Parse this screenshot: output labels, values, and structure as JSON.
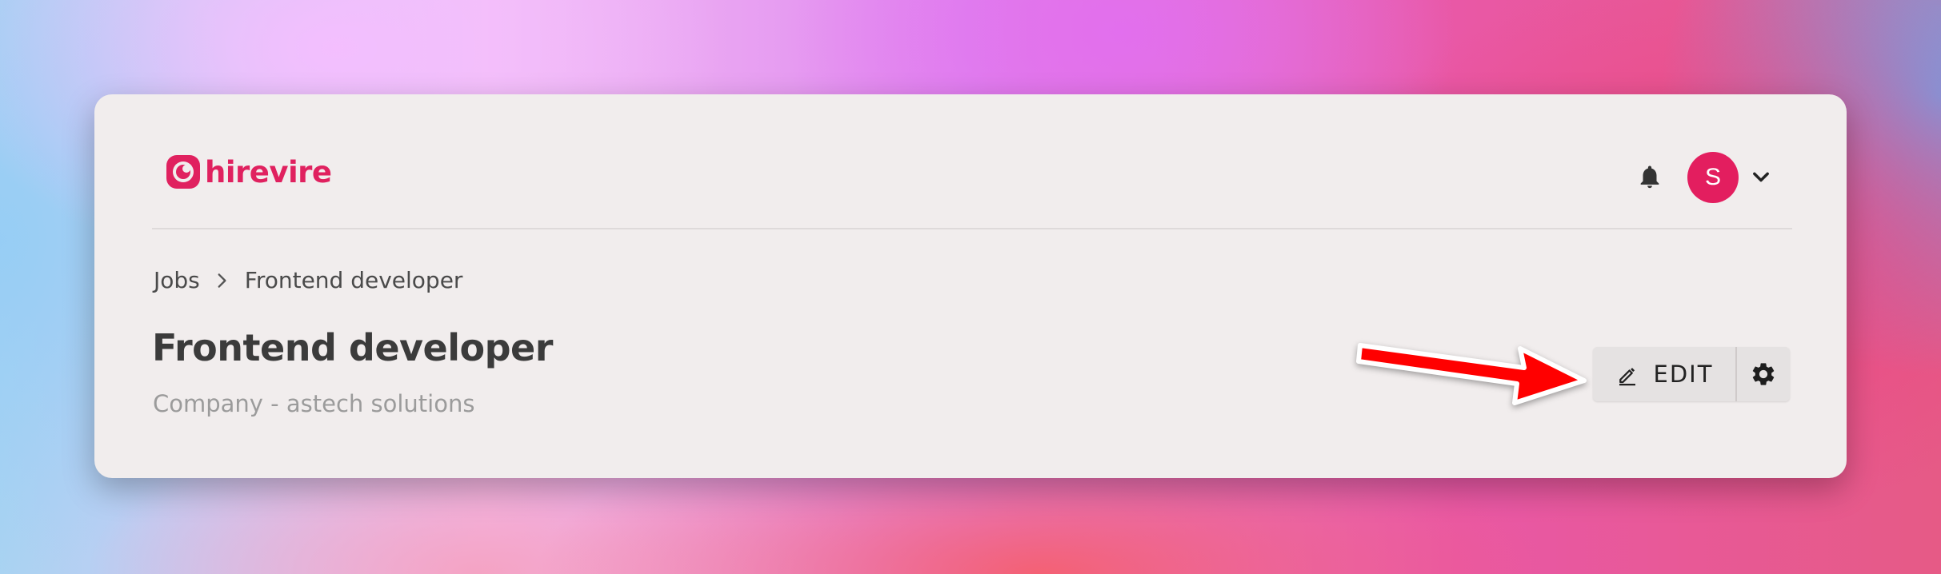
{
  "brand": {
    "name": "hirevire",
    "color": "#e0215f"
  },
  "header": {
    "notification_icon": "bell-icon",
    "avatar_initial": "S",
    "avatar_color": "#e31e5f",
    "menu_icon": "chevron-down-icon"
  },
  "breadcrumb": {
    "items": [
      {
        "label": "Jobs"
      },
      {
        "label": "Frontend developer"
      }
    ],
    "separator_icon": "chevron-right-icon"
  },
  "page": {
    "title": "Frontend developer",
    "subtitle": "Company - astech solutions"
  },
  "actions": {
    "edit_label": "EDIT",
    "edit_icon": "pencil-icon",
    "settings_icon": "gear-icon"
  },
  "annotation": {
    "arrow_color": "#ff0000",
    "arrow_icon": "arrow-right-icon"
  }
}
